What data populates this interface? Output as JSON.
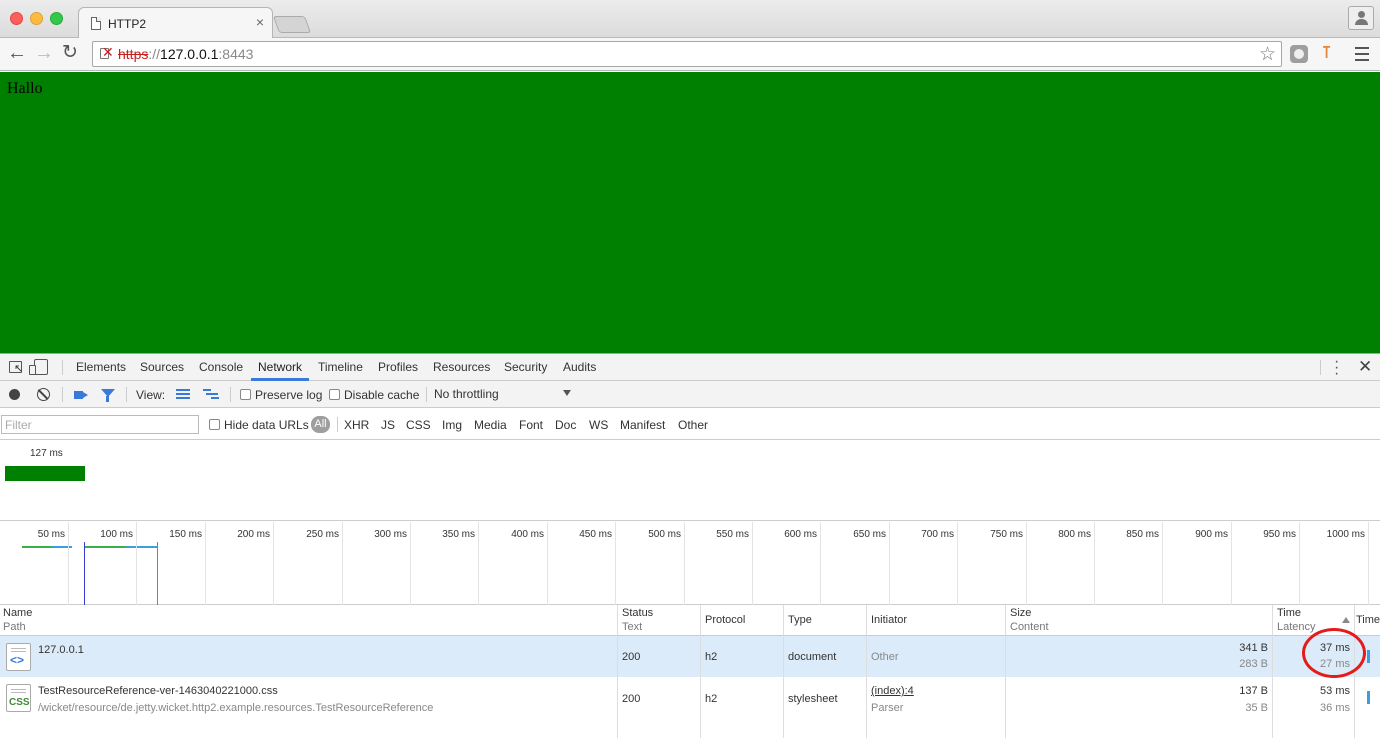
{
  "browser": {
    "tab_title": "HTTP2",
    "tab_close": "×",
    "url": {
      "scheme": "https",
      "sep": "://",
      "host": "127.0.0.1",
      "port": ":8443"
    }
  },
  "page": {
    "text": "Hallo",
    "background": "#008000"
  },
  "devtools": {
    "tabs": [
      "Elements",
      "Sources",
      "Console",
      "Network",
      "Timeline",
      "Profiles",
      "Resources",
      "Security",
      "Audits"
    ],
    "active_tab": "Network",
    "toolbar": {
      "view_label": "View:",
      "preserve_log": "Preserve log",
      "disable_cache": "Disable cache",
      "throttling": "No throttling"
    },
    "filter": {
      "placeholder": "Filter",
      "hide_data_urls": "Hide data URLs",
      "types": [
        "All",
        "XHR",
        "JS",
        "CSS",
        "Img",
        "Media",
        "Font",
        "Doc",
        "WS",
        "Manifest",
        "Other"
      ]
    },
    "overview": {
      "label": "127 ms",
      "bar_color": "#008000"
    },
    "timeline_ticks": [
      "50 ms",
      "100 ms",
      "150 ms",
      "200 ms",
      "250 ms",
      "300 ms",
      "350 ms",
      "400 ms",
      "450 ms",
      "500 ms",
      "550 ms",
      "600 ms",
      "650 ms",
      "700 ms",
      "750 ms",
      "800 ms",
      "850 ms",
      "900 ms",
      "950 ms",
      "1000 ms"
    ],
    "columns": {
      "name": "Name",
      "name_sub": "Path",
      "status": "Status",
      "status_sub": "Text",
      "protocol": "Protocol",
      "type": "Type",
      "initiator": "Initiator",
      "size": "Size",
      "size_sub": "Content",
      "time": "Time",
      "time_sub": "Latency",
      "timeline": "Timeline"
    },
    "rows": [
      {
        "icon": "document-icon",
        "name": "127.0.0.1",
        "path": "",
        "status": "200",
        "protocol": "h2",
        "type": "document",
        "initiator": "Other",
        "initiator_sub": "",
        "size": "341 B",
        "content": "283 B",
        "time": "37 ms",
        "latency": "27 ms"
      },
      {
        "icon": "css-file-icon",
        "name": "TestResourceReference-ver-1463040221000.css",
        "path": "/wicket/resource/de.jetty.wicket.http2.example.resources.TestResourceReference",
        "status": "200",
        "protocol": "h2",
        "type": "stylesheet",
        "initiator": "(index):4",
        "initiator_sub": "Parser",
        "size": "137 B",
        "content": "35 B",
        "time": "53 ms",
        "latency": "36 ms"
      }
    ],
    "accent_color": "#3879d9",
    "highlight_color": "#e41b1b"
  }
}
